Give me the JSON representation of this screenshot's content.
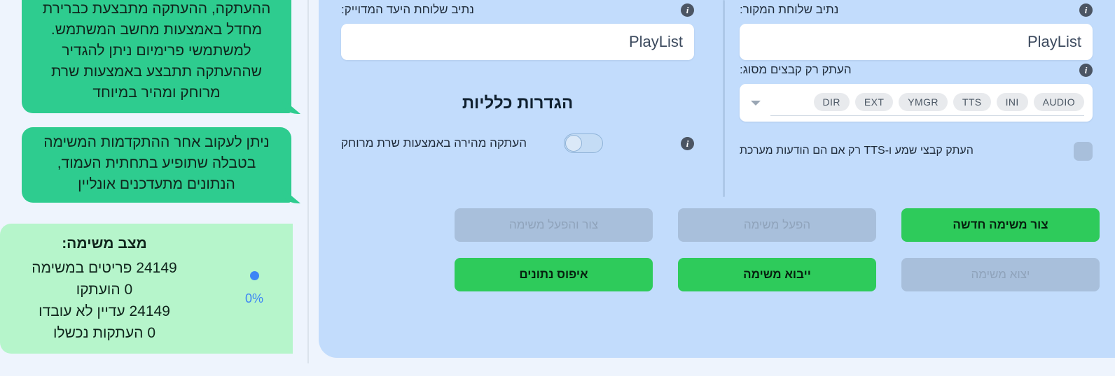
{
  "chat": {
    "bubbles": [
      {
        "id": "copy-info-bubble",
        "text": "ההעתקה, ההעתקה מתבצעת כברירת מחדל באמצעות מחשב המשתמש. למשתמשי פרימיום ניתן להגדיר שההעתקה תתבצע באמצעות שרת מרוחק ומהיר במיוחד"
      },
      {
        "id": "progress-info-bubble",
        "text": "ניתן לעקוב אחר ההתקדמות המשימה בטבלה שתופיע בתחתית העמוד, הנתונים מתעדכנים אונליין"
      }
    ]
  },
  "status": {
    "title": "מצב משימה:",
    "lines": [
      "24149 פריטים במשימה",
      "0 הועתקו",
      "24149 עדיין לא עובדו",
      "0 העתקות נכשלו"
    ],
    "progress_percent": "0%",
    "progress_color": "#3d85f5",
    "box_color": "#b6f5cb"
  },
  "settings": {
    "source": {
      "path_label": "נתיב שלוחת המקור:",
      "path_value": "PlayList",
      "path_placeholder": "PlayList",
      "filetype_label": "העתק רק קבצים מסוג:",
      "chips": [
        "AUDIO",
        "INI",
        "TTS",
        "YMGR",
        "EXT",
        "DIR"
      ],
      "checkbox_label": "העתק קבצי שמע ו-TTS רק אם הם הודעות מערכת",
      "checkbox_checked": false
    },
    "target": {
      "path_label": "נתיב שלוחת היעד המדוייק:",
      "path_value": "PlayList",
      "path_placeholder": "PlayList"
    },
    "general": {
      "heading": "הגדרות כלליות",
      "toggle_label": "העתקה מהירה באמצעות שרת מרוחק",
      "toggle_on": false
    },
    "info_icon_glyph": "i"
  },
  "actions": [
    {
      "id": "create-new-task",
      "label": "צור משימה חדשה",
      "state": "enabled"
    },
    {
      "id": "run-task",
      "label": "הפעל משימה",
      "state": "disabled"
    },
    {
      "id": "create-and-run",
      "label": "צור והפעל משימה",
      "state": "disabled"
    },
    {
      "id": "export-task",
      "label": "יצוא משימה",
      "state": "disabled"
    },
    {
      "id": "import-task",
      "label": "ייבוא משימה",
      "state": "enabled"
    },
    {
      "id": "reset-data",
      "label": "איפוס נתונים",
      "state": "enabled"
    }
  ],
  "theme": {
    "page_bg": "#eef4fd",
    "panel_bg": "#c2dcfc",
    "accent_green": "#2ecb5b",
    "bubble_green": "#2ecc8f",
    "disabled_grey": "#a8bfdb"
  }
}
